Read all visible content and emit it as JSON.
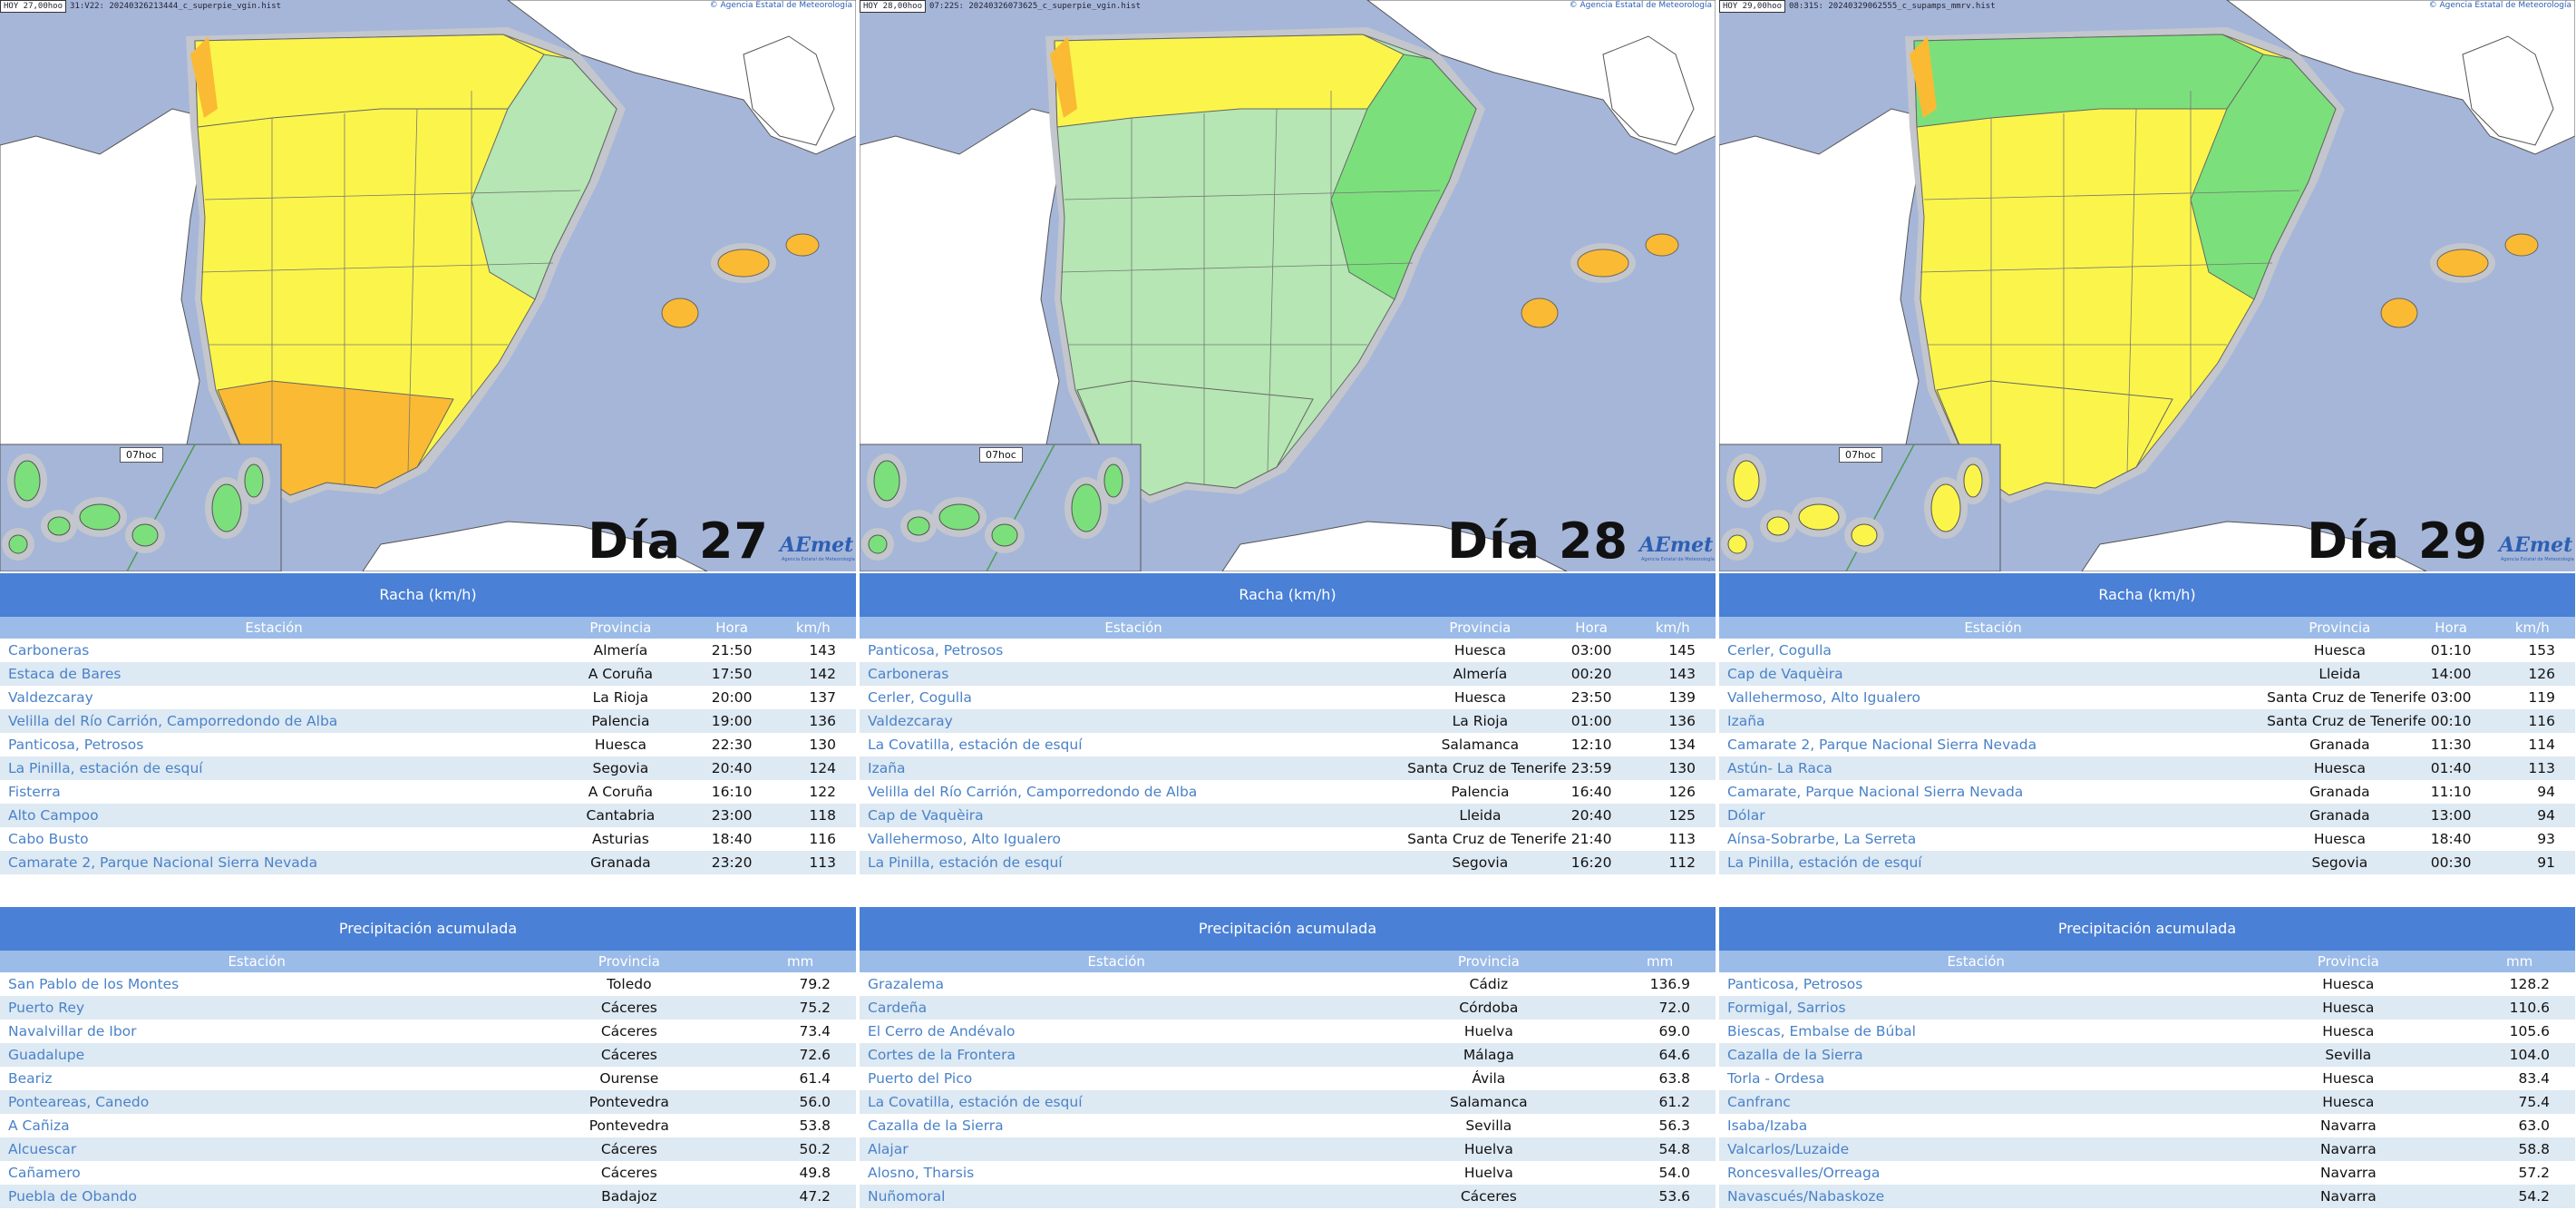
{
  "copyright": "© Agencia Estatal de Meteorología",
  "columns": [
    {
      "day_label": "Día 27",
      "hoy": "HOY 27,00hoo",
      "file": "31:V22: 20240326213444_c_superpie_vgin.hist",
      "time_badge": "07hoc",
      "logo": "AEmet",
      "logo_sub": "Agencia Estatal de Meteorología",
      "racha": {
        "title": "Racha (km/h)",
        "headers": [
          "Estación",
          "Provincia",
          "Hora",
          "km/h"
        ],
        "rows": [
          {
            "station": "Carboneras",
            "province": "Almería",
            "time": "21:50",
            "value": "143"
          },
          {
            "station": "Estaca de Bares",
            "province": "A Coruña",
            "time": "17:50",
            "value": "142"
          },
          {
            "station": "Valdezcaray",
            "province": "La Rioja",
            "time": "20:00",
            "value": "137"
          },
          {
            "station": "Velilla del Río Carrión, Camporredondo de Alba",
            "province": "Palencia",
            "time": "19:00",
            "value": "136"
          },
          {
            "station": "Panticosa, Petrosos",
            "province": "Huesca",
            "time": "22:30",
            "value": "130"
          },
          {
            "station": "La Pinilla, estación de esquí",
            "province": "Segovia",
            "time": "20:40",
            "value": "124"
          },
          {
            "station": "Fisterra",
            "province": "A Coruña",
            "time": "16:10",
            "value": "122"
          },
          {
            "station": "Alto Campoo",
            "province": "Cantabria",
            "time": "23:00",
            "value": "118"
          },
          {
            "station": "Cabo Busto",
            "province": "Asturias",
            "time": "18:40",
            "value": "116"
          },
          {
            "station": "Camarate 2, Parque Nacional Sierra Nevada",
            "province": "Granada",
            "time": "23:20",
            "value": "113"
          }
        ]
      },
      "precip": {
        "title": "Precipitación acumulada",
        "headers": [
          "Estación",
          "Provincia",
          "mm"
        ],
        "rows": [
          {
            "station": "San Pablo de los Montes",
            "province": "Toledo",
            "value": "79.2"
          },
          {
            "station": "Puerto Rey",
            "province": "Cáceres",
            "value": "75.2"
          },
          {
            "station": "Navalvillar de Ibor",
            "province": "Cáceres",
            "value": "73.4"
          },
          {
            "station": "Guadalupe",
            "province": "Cáceres",
            "value": "72.6"
          },
          {
            "station": "Beariz",
            "province": "Ourense",
            "value": "61.4"
          },
          {
            "station": "Ponteareas, Canedo",
            "province": "Pontevedra",
            "value": "56.0"
          },
          {
            "station": "A Cañiza",
            "province": "Pontevedra",
            "value": "53.8"
          },
          {
            "station": "Alcuescar",
            "province": "Cáceres",
            "value": "50.2"
          },
          {
            "station": "Cañamero",
            "province": "Cáceres",
            "value": "49.8"
          },
          {
            "station": "Puebla de Obando",
            "province": "Badajoz",
            "value": "47.2"
          }
        ]
      }
    },
    {
      "day_label": "Día 28",
      "hoy": "HOY 28,00hoo",
      "file": "07:22S: 20240326073625_c_superpie_vgin.hist",
      "time_badge": "07hoc",
      "logo": "AEmet",
      "logo_sub": "Agencia Estatal de Meteorología",
      "racha": {
        "title": "Racha (km/h)",
        "headers": [
          "Estación",
          "Provincia",
          "Hora",
          "km/h"
        ],
        "rows": [
          {
            "station": "Panticosa, Petrosos",
            "province": "Huesca",
            "time": "03:00",
            "value": "145"
          },
          {
            "station": "Carboneras",
            "province": "Almería",
            "time": "00:20",
            "value": "143"
          },
          {
            "station": "Cerler, Cogulla",
            "province": "Huesca",
            "time": "23:50",
            "value": "139"
          },
          {
            "station": "Valdezcaray",
            "province": "La Rioja",
            "time": "01:00",
            "value": "136"
          },
          {
            "station": "La Covatilla, estación de esquí",
            "province": "Salamanca",
            "time": "12:10",
            "value": "134"
          },
          {
            "station": "Izaña",
            "province": "Santa Cruz de Tenerife",
            "time": "23:59",
            "value": "130"
          },
          {
            "station": "Velilla del Río Carrión, Camporredondo de Alba",
            "province": "Palencia",
            "time": "16:40",
            "value": "126"
          },
          {
            "station": "Cap de Vaquèira",
            "province": "Lleida",
            "time": "20:40",
            "value": "125"
          },
          {
            "station": "Vallehermoso, Alto Igualero",
            "province": "Santa Cruz de Tenerife",
            "time": "21:40",
            "value": "113"
          },
          {
            "station": "La Pinilla, estación de esquí",
            "province": "Segovia",
            "time": "16:20",
            "value": "112"
          }
        ]
      },
      "precip": {
        "title": "Precipitación acumulada",
        "headers": [
          "Estación",
          "Provincia",
          "mm"
        ],
        "rows": [
          {
            "station": "Grazalema",
            "province": "Cádiz",
            "value": "136.9"
          },
          {
            "station": "Cardeña",
            "province": "Córdoba",
            "value": "72.0"
          },
          {
            "station": "El Cerro de Andévalo",
            "province": "Huelva",
            "value": "69.0"
          },
          {
            "station": "Cortes de la Frontera",
            "province": "Málaga",
            "value": "64.6"
          },
          {
            "station": "Puerto del Pico",
            "province": "Ávila",
            "value": "63.8"
          },
          {
            "station": "La Covatilla, estación de esquí",
            "province": "Salamanca",
            "value": "61.2"
          },
          {
            "station": "Cazalla de la Sierra",
            "province": "Sevilla",
            "value": "56.3"
          },
          {
            "station": "Alajar",
            "province": "Huelva",
            "value": "54.8"
          },
          {
            "station": "Alosno, Tharsis",
            "province": "Huelva",
            "value": "54.0"
          },
          {
            "station": "Nuñomoral",
            "province": "Cáceres",
            "value": "53.6"
          }
        ]
      }
    },
    {
      "day_label": "Día 29",
      "hoy": "HOY 29,00hoo",
      "file": "08:31S: 20240329062555_c_supamps_mmrv.hist",
      "time_badge": "07hoc",
      "logo": "AEmet",
      "logo_sub": "Agencia Estatal de Meteorología",
      "racha": {
        "title": "Racha (km/h)",
        "headers": [
          "Estación",
          "Provincia",
          "Hora",
          "km/h"
        ],
        "rows": [
          {
            "station": "Cerler, Cogulla",
            "province": "Huesca",
            "time": "01:10",
            "value": "153"
          },
          {
            "station": "Cap de Vaquèira",
            "province": "Lleida",
            "time": "14:00",
            "value": "126"
          },
          {
            "station": "Vallehermoso, Alto Igualero",
            "province": "Santa Cruz de Tenerife",
            "time": "03:00",
            "value": "119"
          },
          {
            "station": "Izaña",
            "province": "Santa Cruz de Tenerife",
            "time": "00:10",
            "value": "116"
          },
          {
            "station": "Camarate 2, Parque Nacional Sierra Nevada",
            "province": "Granada",
            "time": "11:30",
            "value": "114"
          },
          {
            "station": "Astún- La Raca",
            "province": "Huesca",
            "time": "01:40",
            "value": "113"
          },
          {
            "station": "Camarate, Parque Nacional Sierra Nevada",
            "province": "Granada",
            "time": "11:10",
            "value": "94"
          },
          {
            "station": "Dólar",
            "province": "Granada",
            "time": "13:00",
            "value": "94"
          },
          {
            "station": "Aínsa-Sobrarbe, La Serreta",
            "province": "Huesca",
            "time": "18:40",
            "value": "93"
          },
          {
            "station": "La Pinilla, estación de esquí",
            "province": "Segovia",
            "time": "00:30",
            "value": "91"
          }
        ]
      },
      "precip": {
        "title": "Precipitación acumulada",
        "headers": [
          "Estación",
          "Provincia",
          "mm"
        ],
        "rows": [
          {
            "station": "Panticosa, Petrosos",
            "province": "Huesca",
            "value": "128.2"
          },
          {
            "station": "Formigal, Sarrios",
            "province": "Huesca",
            "value": "110.6"
          },
          {
            "station": "Biescas, Embalse de Búbal",
            "province": "Huesca",
            "value": "105.6"
          },
          {
            "station": "Cazalla de la Sierra",
            "province": "Sevilla",
            "value": "104.0"
          },
          {
            "station": "Torla - Ordesa",
            "province": "Huesca",
            "value": "83.4"
          },
          {
            "station": "Canfranc",
            "province": "Huesca",
            "value": "75.4"
          },
          {
            "station": "Isaba/Izaba",
            "province": "Navarra",
            "value": "63.0"
          },
          {
            "station": "Valcarlos/Luzaide",
            "province": "Navarra",
            "value": "58.8"
          },
          {
            "station": "Roncesvalles/Orreaga",
            "province": "Navarra",
            "value": "57.2"
          },
          {
            "station": "Navascués/Nabaskoze",
            "province": "Navarra",
            "value": "54.2"
          }
        ]
      }
    }
  ],
  "colors": {
    "sea": "#a6b6d9",
    "land_other": "#ffffff",
    "warning_none": "#b5e6b3",
    "warning_green": "#7be07b",
    "warning_yellow": "#fbf54b",
    "warning_orange": "#fbba33",
    "border_halo": "#c3c6cc",
    "header_blue": "#4a80d6",
    "subheader_blue": "#9bbbe8",
    "row_alt": "#dde9f3",
    "link": "#4a82c8"
  }
}
